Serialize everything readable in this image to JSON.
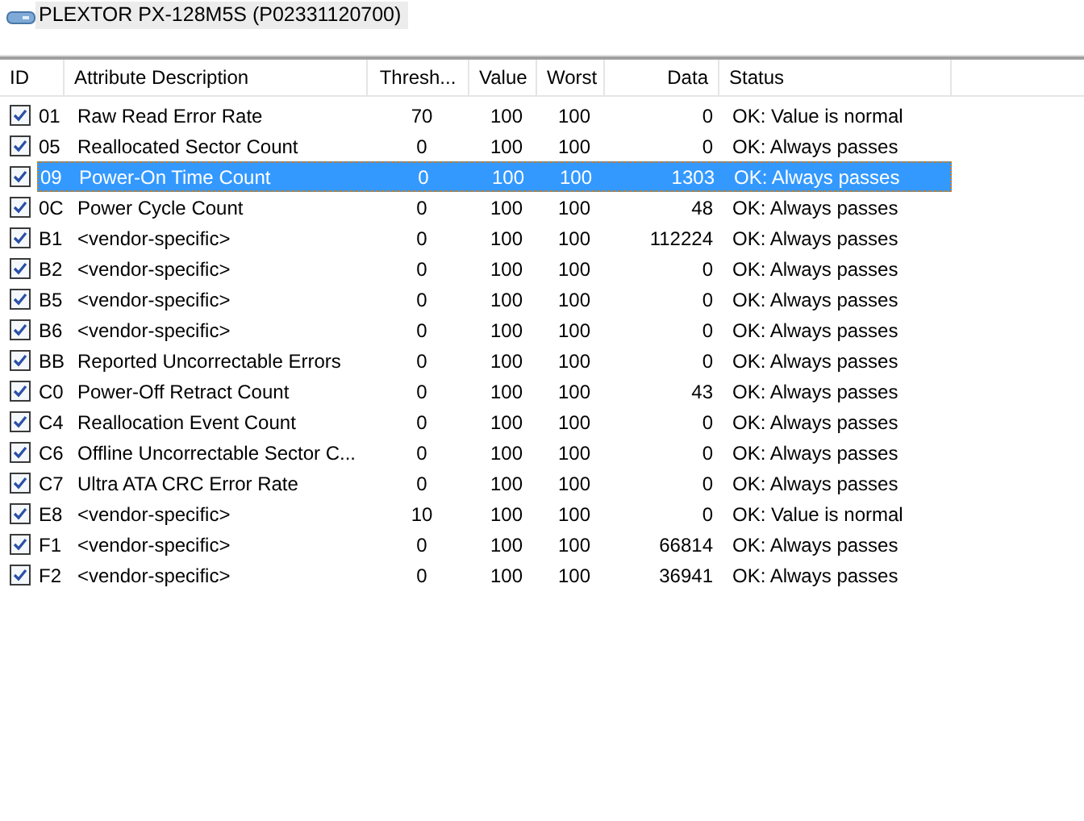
{
  "drive": {
    "title": "PLEXTOR PX-128M5S (P02331120700)"
  },
  "table": {
    "columns": [
      "ID",
      "Attribute Description",
      "Thresh...",
      "Value",
      "Worst",
      "Data",
      "Status"
    ],
    "rows": [
      {
        "checked": true,
        "selected": false,
        "cells": [
          "01",
          "Raw Read Error Rate",
          "70",
          "100",
          "100",
          "0",
          "OK: Value is normal"
        ]
      },
      {
        "checked": true,
        "selected": false,
        "cells": [
          "05",
          "Reallocated Sector Count",
          "0",
          "100",
          "100",
          "0",
          "OK: Always passes"
        ]
      },
      {
        "checked": true,
        "selected": true,
        "cells": [
          "09",
          "Power-On Time Count",
          "0",
          "100",
          "100",
          "1303",
          "OK: Always passes"
        ]
      },
      {
        "checked": true,
        "selected": false,
        "cells": [
          "0C",
          "Power Cycle Count",
          "0",
          "100",
          "100",
          "48",
          "OK: Always passes"
        ]
      },
      {
        "checked": true,
        "selected": false,
        "cells": [
          "B1",
          "<vendor-specific>",
          "0",
          "100",
          "100",
          "112224",
          "OK: Always passes"
        ]
      },
      {
        "checked": true,
        "selected": false,
        "cells": [
          "B2",
          "<vendor-specific>",
          "0",
          "100",
          "100",
          "0",
          "OK: Always passes"
        ]
      },
      {
        "checked": true,
        "selected": false,
        "cells": [
          "B5",
          "<vendor-specific>",
          "0",
          "100",
          "100",
          "0",
          "OK: Always passes"
        ]
      },
      {
        "checked": true,
        "selected": false,
        "cells": [
          "B6",
          "<vendor-specific>",
          "0",
          "100",
          "100",
          "0",
          "OK: Always passes"
        ]
      },
      {
        "checked": true,
        "selected": false,
        "cells": [
          "BB",
          "Reported Uncorrectable Errors",
          "0",
          "100",
          "100",
          "0",
          "OK: Always passes"
        ]
      },
      {
        "checked": true,
        "selected": false,
        "cells": [
          "C0",
          "Power-Off Retract Count",
          "0",
          "100",
          "100",
          "43",
          "OK: Always passes"
        ]
      },
      {
        "checked": true,
        "selected": false,
        "cells": [
          "C4",
          "Reallocation Event Count",
          "0",
          "100",
          "100",
          "0",
          "OK: Always passes"
        ]
      },
      {
        "checked": true,
        "selected": false,
        "cells": [
          "C6",
          "Offline Uncorrectable Sector C...",
          "0",
          "100",
          "100",
          "0",
          "OK: Always passes"
        ]
      },
      {
        "checked": true,
        "selected": false,
        "cells": [
          "C7",
          "Ultra ATA CRC Error Rate",
          "0",
          "100",
          "100",
          "0",
          "OK: Always passes"
        ]
      },
      {
        "checked": true,
        "selected": false,
        "cells": [
          "E8",
          "<vendor-specific>",
          "10",
          "100",
          "100",
          "0",
          "OK: Value is normal"
        ]
      },
      {
        "checked": true,
        "selected": false,
        "cells": [
          "F1",
          "<vendor-specific>",
          "0",
          "100",
          "100",
          "66814",
          "OK: Always passes"
        ]
      },
      {
        "checked": true,
        "selected": false,
        "cells": [
          "F2",
          "<vendor-specific>",
          "0",
          "100",
          "100",
          "36941",
          "OK: Always passes"
        ]
      }
    ]
  }
}
